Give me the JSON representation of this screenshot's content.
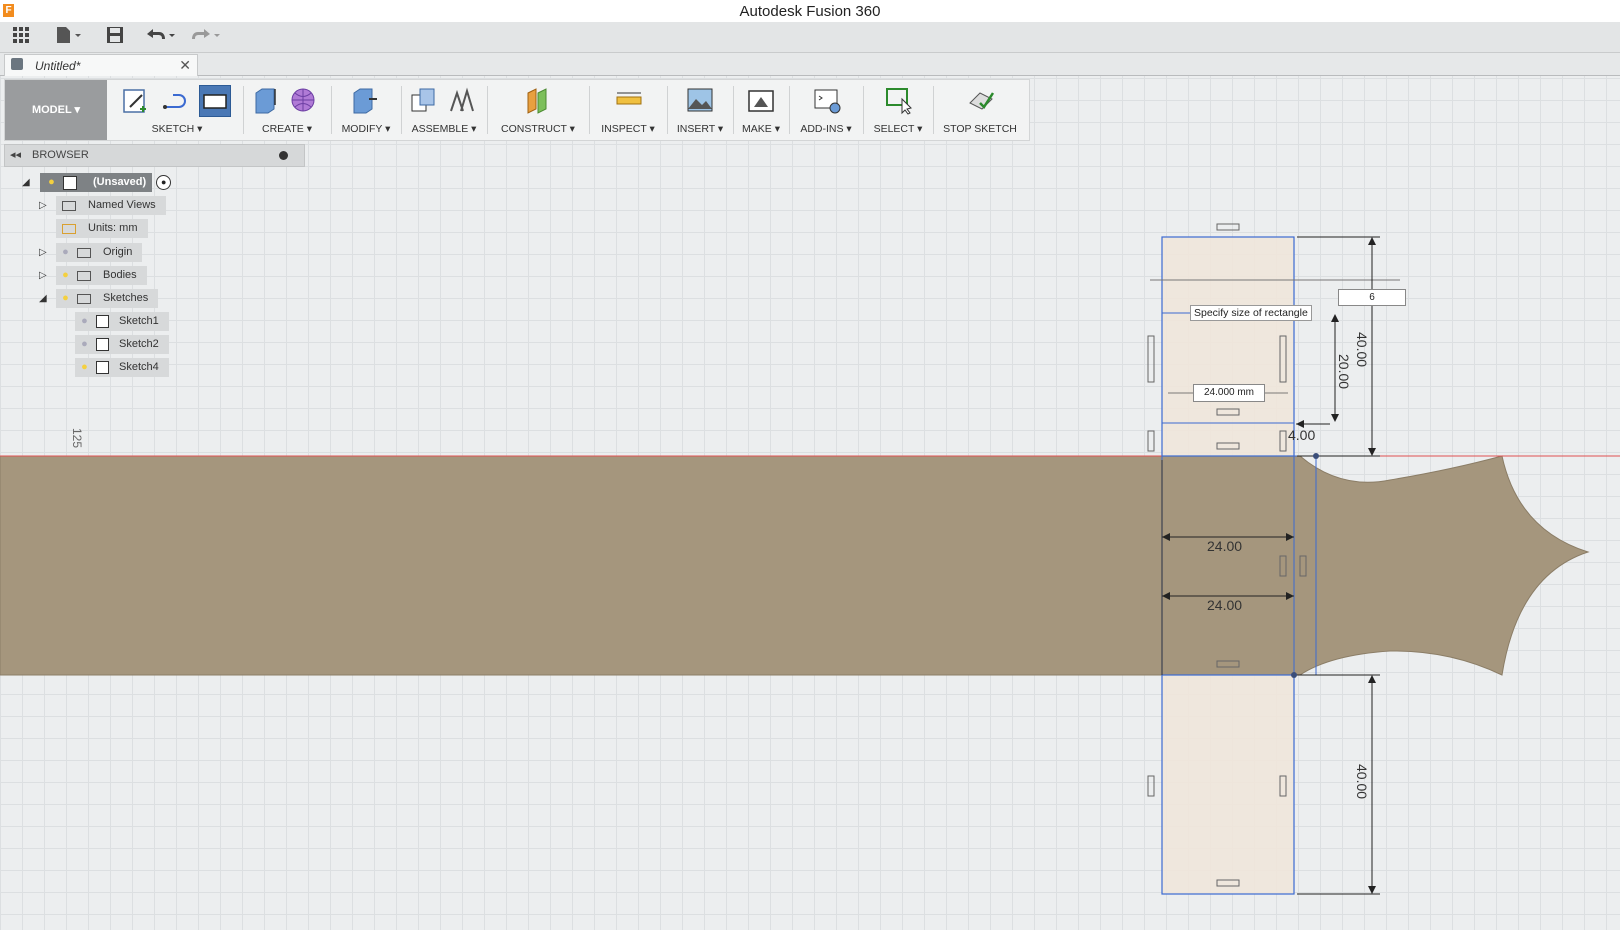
{
  "app": {
    "title": "Autodesk Fusion 360",
    "logo": "F"
  },
  "document": {
    "tab_name": "Untitled*"
  },
  "toolbar": {
    "mode": "MODEL",
    "groups": {
      "sketch": "SKETCH",
      "create": "CREATE",
      "modify": "MODIFY",
      "assemble": "ASSEMBLE",
      "construct": "CONSTRUCT",
      "inspect": "INSPECT",
      "insert": "INSERT",
      "make": "MAKE",
      "addins": "ADD-INS",
      "select": "SELECT",
      "stop": "STOP SKETCH"
    }
  },
  "browser": {
    "title": "BROWSER",
    "root": "(Unsaved)",
    "items": {
      "named_views": "Named Views",
      "units": "Units: mm",
      "origin": "Origin",
      "bodies": "Bodies",
      "sketches": "Sketches",
      "sketch1": "Sketch1",
      "sketch2": "Sketch2",
      "sketch4": "Sketch4"
    }
  },
  "canvas": {
    "ruler_label": "125",
    "input_value": "6",
    "tooltip": "Specify size of rectangle",
    "width_input": "24.000 mm",
    "dims": {
      "top_height": "40.00",
      "inner_height": "20.00",
      "small": "4.00",
      "width_a": "24.00",
      "width_b": "24.00",
      "bottom_height": "40.00"
    }
  },
  "colors": {
    "body": "#a5967d",
    "sketch_fill": "#efe6da",
    "sketch_line": "#3b6ad1",
    "axis_red": "#e05050",
    "toolbar_active": "#4a78b5"
  }
}
